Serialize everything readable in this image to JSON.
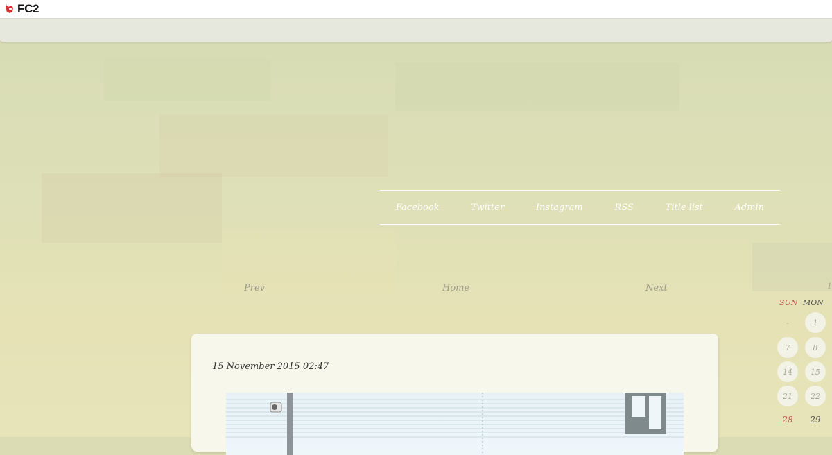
{
  "header": {
    "brand": "FC2"
  },
  "nav": {
    "items": [
      "Facebook",
      "Twitter",
      "Instagram",
      "RSS",
      "Title list",
      "Admin"
    ]
  },
  "pager": {
    "prev": "Prev",
    "home": "Home",
    "next": "Next"
  },
  "post": {
    "date": "15 November 2015 02:47"
  },
  "calendar": {
    "edge_glyph": "1",
    "weekdays": {
      "sun": "SUN",
      "mon": "MON"
    },
    "rows": [
      {
        "sun": "-",
        "mon": "1"
      },
      {
        "sun": "7",
        "mon": "8"
      },
      {
        "sun": "14",
        "mon": "15"
      },
      {
        "sun": "21",
        "mon": "22"
      },
      {
        "sun": "28",
        "mon": "29"
      }
    ]
  },
  "colors": {
    "accent_red": "#c0504d",
    "card_bg": "#f7f7ec",
    "page_bg": "#dcdcb4"
  },
  "icons": {
    "brand": "fc2-logo-icon"
  }
}
